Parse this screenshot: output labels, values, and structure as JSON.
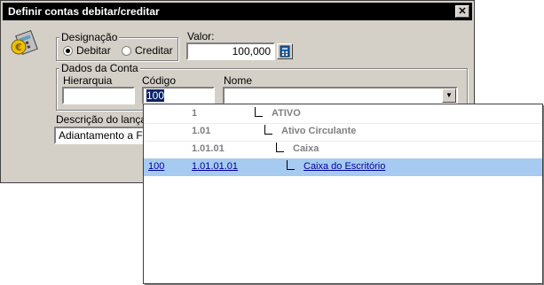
{
  "window": {
    "title": "Definir contas debitar/creditar",
    "close_label": "✕"
  },
  "designacao": {
    "legend": "Designação",
    "options": [
      {
        "label": "Debitar",
        "selected": true
      },
      {
        "label": "Creditar",
        "selected": false
      }
    ]
  },
  "valor": {
    "label": "Valor:",
    "value": "100,000"
  },
  "dados_conta": {
    "legend": "Dados da Conta",
    "hierarquia_label": "Hierarquia",
    "hierarquia_value": "",
    "codigo_label": "Código",
    "codigo_value": "100",
    "nome_label": "Nome",
    "nome_value": ""
  },
  "descricao": {
    "label": "Descrição do lançam",
    "value": "Adiantamento a For"
  },
  "dropdown": {
    "rows": [
      {
        "code": "",
        "hier": "1",
        "name": "ATIVO",
        "highlighted": false
      },
      {
        "code": "",
        "hier": "1.01",
        "name": "Ativo Circulante",
        "highlighted": false
      },
      {
        "code": "",
        "hier": "1.01.01",
        "name": "Caixa",
        "highlighted": false
      },
      {
        "code": "100",
        "hier": "1.01.01.01",
        "name": "Caixa do Escritório",
        "highlighted": true
      }
    ]
  },
  "colors": {
    "highlight": "#a6caf0",
    "link": "#00009c",
    "face": "#d4d0c8"
  }
}
